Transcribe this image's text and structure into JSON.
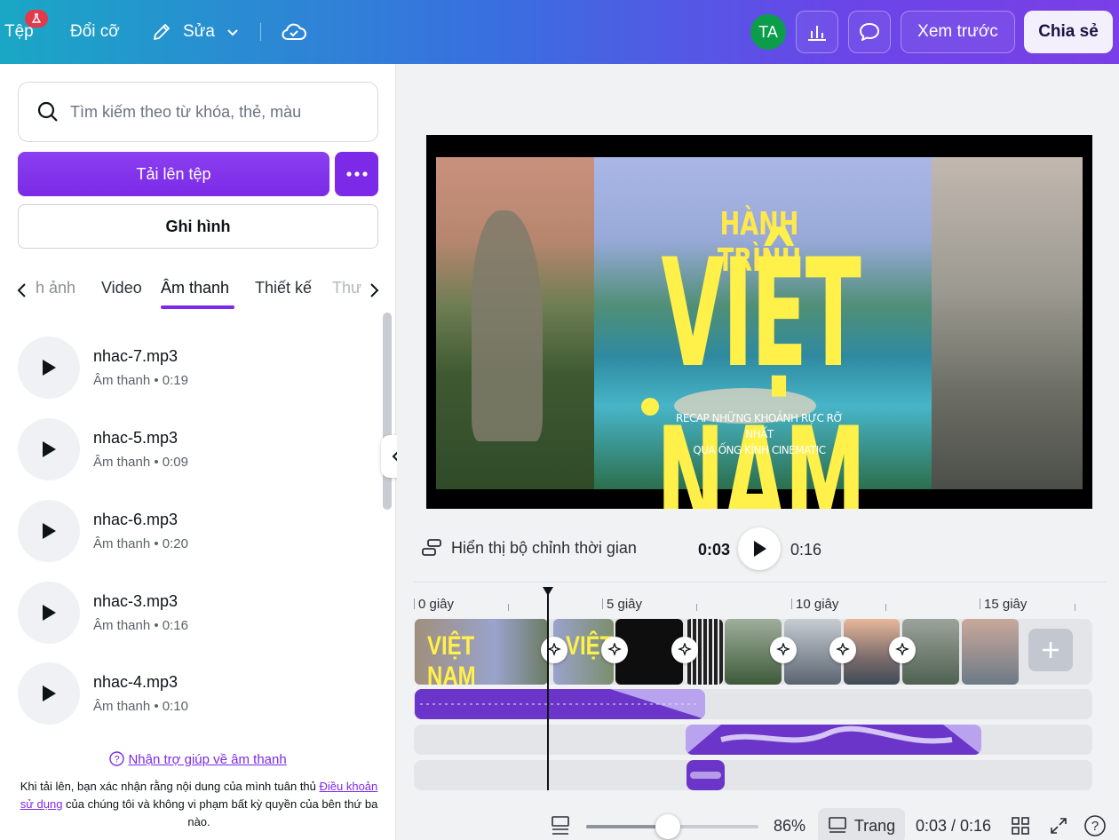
{
  "topbar": {
    "file_label": "Tệp",
    "resize_label": "Đổi cỡ",
    "edit_label": "Sửa",
    "avatar_initials": "TA",
    "preview_label": "Xem trước",
    "share_label": "Chia sẻ",
    "gradient": [
      "#1aa7c5",
      "#6a45e8"
    ]
  },
  "left_panel": {
    "search_placeholder": "Tìm kiếm theo từ khóa, thẻ, màu",
    "upload_label": "Tải lên tệp",
    "record_label": "Ghi hình",
    "tabs": [
      {
        "label": "h ảnh"
      },
      {
        "label": "Video"
      },
      {
        "label": "Âm thanh",
        "active": true
      },
      {
        "label": "Thiết kế"
      },
      {
        "label": "Thư"
      }
    ],
    "audio_items": [
      {
        "name": "nhac-7.mp3",
        "meta": "Âm thanh • 0:19"
      },
      {
        "name": "nhac-5.mp3",
        "meta": "Âm thanh • 0:09"
      },
      {
        "name": "nhac-6.mp3",
        "meta": "Âm thanh • 0:20"
      },
      {
        "name": "nhac-3.mp3",
        "meta": "Âm thanh • 0:16"
      },
      {
        "name": "nhac-4.mp3",
        "meta": "Âm thanh • 0:10"
      }
    ],
    "help_link": "Nhận trợ giúp về âm thanh",
    "legal_prefix": "Khi tải lên, bạn xác nhận rằng nội dung của mình tuân thủ ",
    "legal_link": "Điều khoản sử dụng",
    "legal_suffix": " của chúng tôi và không vi phạm bất kỳ quyền của bên thứ ba nào.",
    "accent": "#7d2ae8"
  },
  "stage": {
    "top_title": "HÀNH TRÌNH",
    "main_title": "VIỆT NAM",
    "subtitle_line1": "RECAP NHỮNG KHOẢNH RỰC RỠ NHẤT",
    "subtitle_line2": "QUA ỐNG KÍNH CINEMATIC",
    "title_color": "#fff04a"
  },
  "playback": {
    "timeline_toggle_label": "Hiển thị bộ chỉnh thời gian",
    "current_time": "0:03",
    "total_time": "0:16"
  },
  "timeline": {
    "ruler_labels": [
      "0 giây",
      "5 giây",
      "10 giây",
      "15 giây"
    ],
    "clip_thumb_text": "VIỆT NAM"
  },
  "bottombar": {
    "zoom": "86%",
    "page_label": "Trang",
    "time_readout": "0:03 / 0:16"
  }
}
